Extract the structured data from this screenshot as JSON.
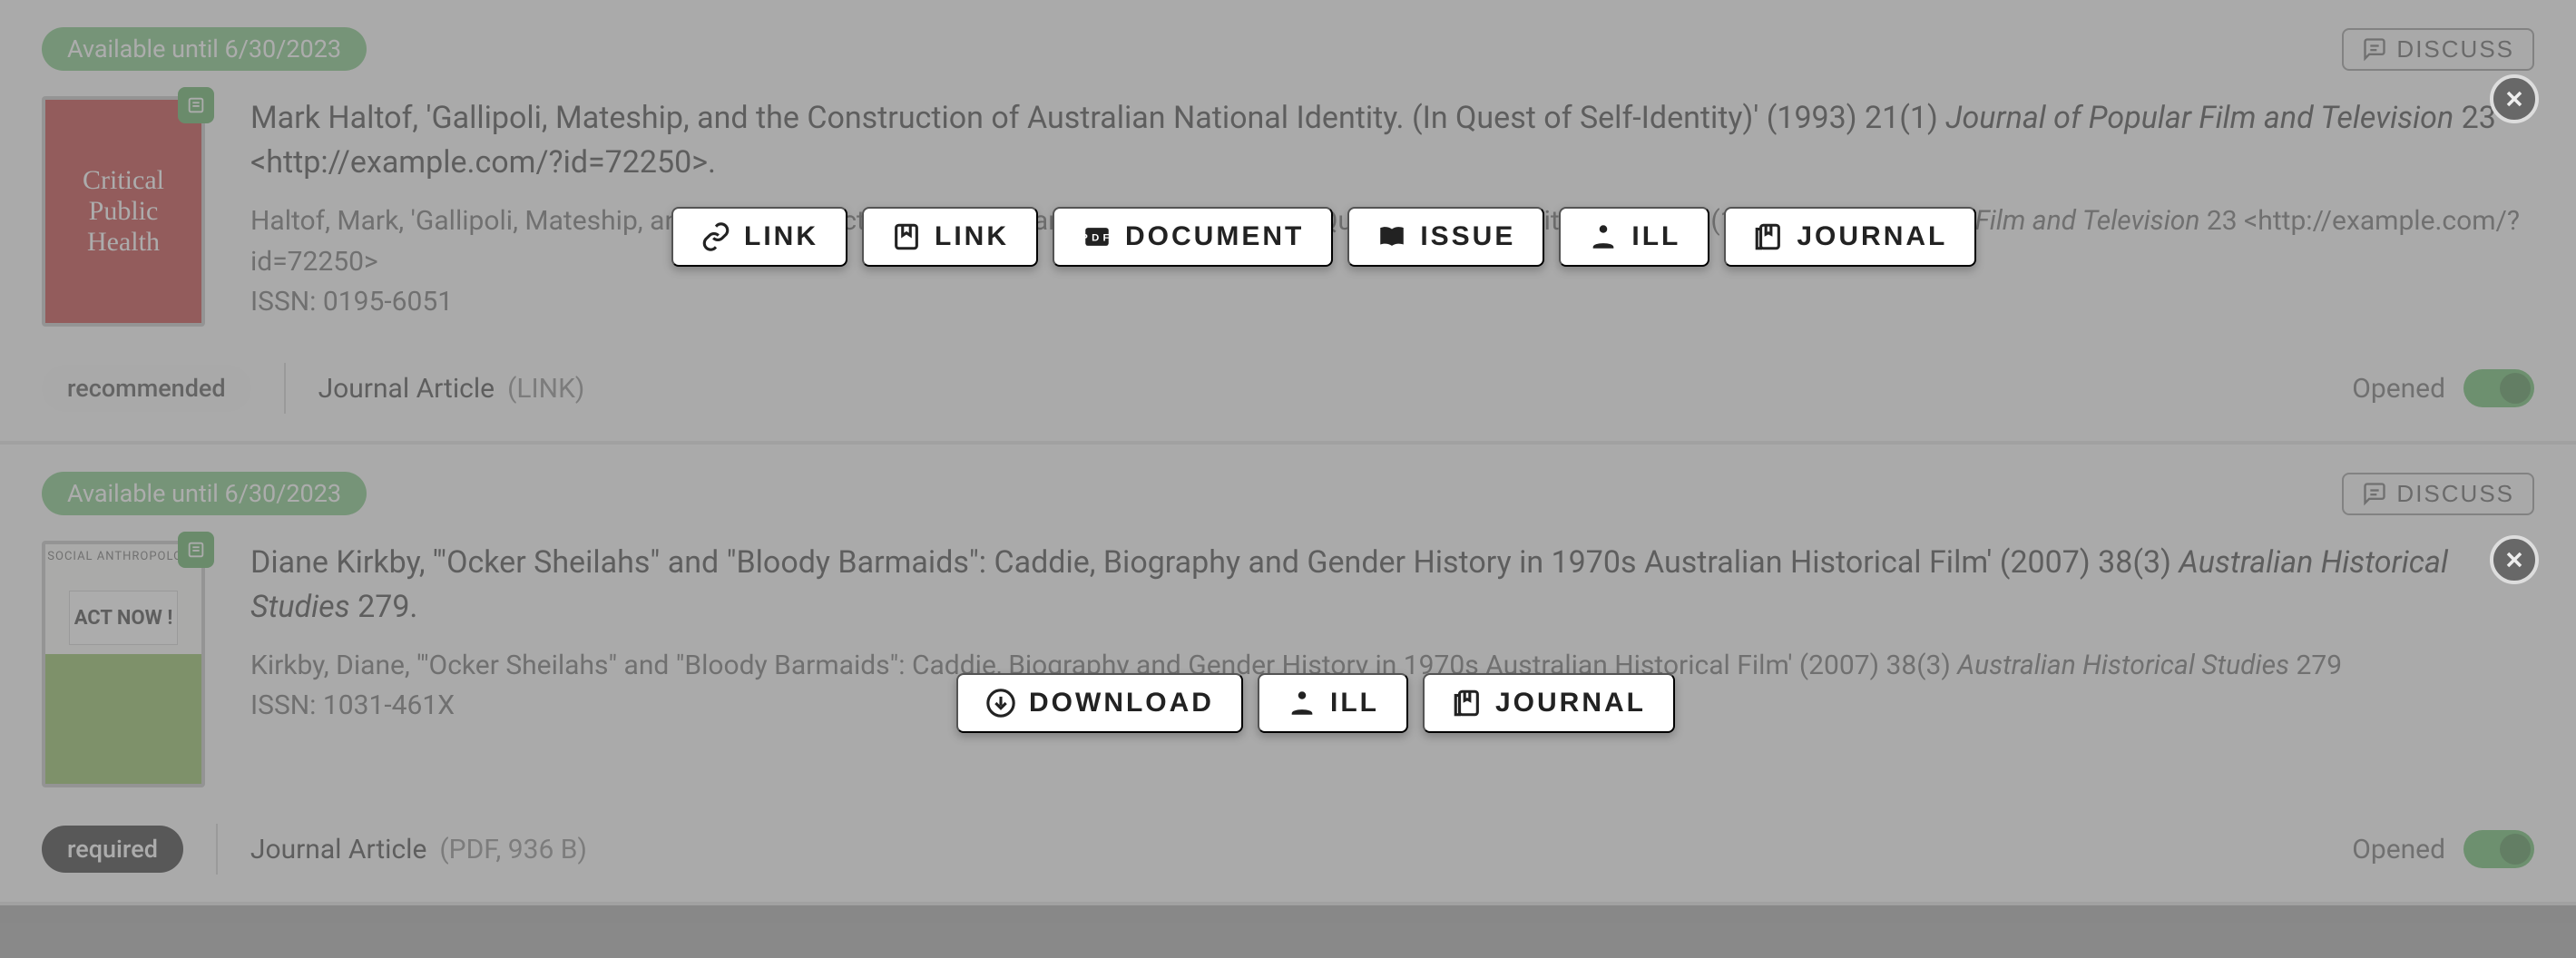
{
  "cards": [
    {
      "availability": "Available until 6/30/2023",
      "discuss_label": "DISCUSS",
      "thumb": {
        "style": "red",
        "line1": "Critical",
        "line2": "Public",
        "line3": "Health"
      },
      "title_prefix": "Mark Haltof, 'Gallipoli, Mateship, and the Construction of Australian National Identity. (In Quest of Self-Identity)' (1993) 21(1) ",
      "title_ital": "Journal of Popular Film and Television",
      "title_suffix": " 23 <http://example.com/?id=72250>.",
      "citation_prefix": "Haltof, Mark, 'Gallipoli, Mateship, and the Construction of Australian National Identity. (In Quest of Self-Identity)' (1993) 21(1) ",
      "citation_ital": "Journal of Popular Film and Television",
      "citation_suffix": " 23 <http://example.com/?id=72250>",
      "issn": "ISSN: 0195-6051",
      "requirement": "recommended",
      "type": "Journal Article",
      "type_detail": "(LINK)",
      "opened_label": "Opened"
    },
    {
      "availability": "Available until 6/30/2023",
      "discuss_label": "DISCUSS",
      "thumb": {
        "style": "white",
        "arc": "SOCIAL ANTHROPOLOGY",
        "sign": "ACT NOW !"
      },
      "title_prefix": "Diane Kirkby, '\"Ocker Sheilahs\" and \"Bloody Barmaids\": Caddie, Biography and Gender History in 1970s Australian Historical Film' (2007) 38(3) ",
      "title_ital": "Australian Historical Studies",
      "title_suffix": " 279.",
      "citation_prefix": "Kirkby, Diane, '\"Ocker Sheilahs\" and \"Bloody Barmaids\": Caddie, Biography and Gender History in 1970s Australian Historical Film' (2007) 38(3) ",
      "citation_ital": "Australian Historical Studies",
      "citation_suffix": " 279",
      "issn": "ISSN: 1031-461X",
      "requirement": "required",
      "type": "Journal Article",
      "type_detail": "(PDF, 936 B)",
      "opened_label": "Opened"
    }
  ],
  "action_bars": [
    {
      "buttons": [
        {
          "icon": "link",
          "label": "LINK"
        },
        {
          "icon": "bookmark",
          "label": "LINK"
        },
        {
          "icon": "pdf",
          "label": "DOCUMENT"
        },
        {
          "icon": "book",
          "label": "ISSUE"
        },
        {
          "icon": "reader",
          "label": "ILL"
        },
        {
          "icon": "journal",
          "label": "JOURNAL"
        }
      ]
    },
    {
      "buttons": [
        {
          "icon": "download",
          "label": "DOWNLOAD"
        },
        {
          "icon": "reader",
          "label": "ILL"
        },
        {
          "icon": "journal",
          "label": "JOURNAL"
        }
      ]
    }
  ]
}
